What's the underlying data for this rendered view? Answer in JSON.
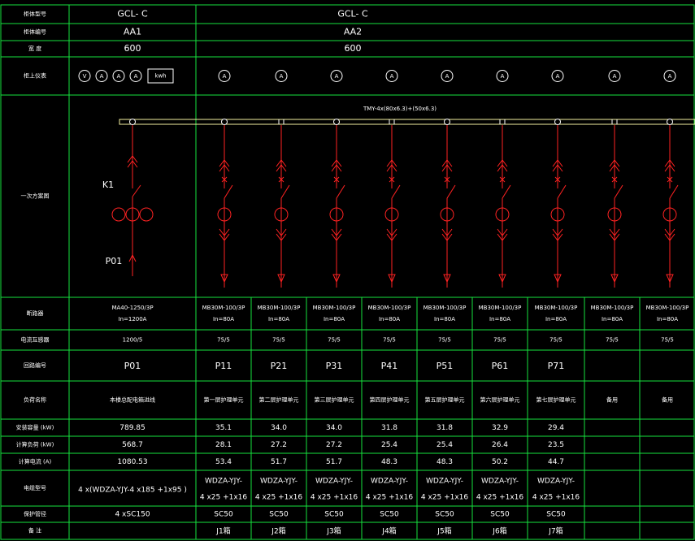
{
  "colors": {
    "background": "#000000",
    "grid": "#16e23e",
    "text": "#ffffff",
    "circuit": "#ff2222",
    "busbar": "#f5f0a0"
  },
  "row_labels": {
    "cabinet_model": "柜体型号",
    "cabinet_number": "柜体编号",
    "width": "宽 度",
    "meters": "柜上仪表",
    "one_line_diagram": "一次方案图",
    "breaker": "断路器",
    "current_transformer": "电流互感器",
    "circuit_number": "回路编号",
    "load_name": "负荷名称",
    "installed_load": "安装容量 (kW)",
    "calculated_load": "计算负荷 (kW)",
    "calculated_current": "计算电流 (A)",
    "cable_model": "电缆型号",
    "conduit": "保护管径",
    "remark": "备 注"
  },
  "header": {
    "aa1": {
      "model": "GCL- C",
      "number": "AA1",
      "width": "600"
    },
    "aa2": {
      "model": "GCL- C",
      "number": "AA2",
      "width": "600"
    }
  },
  "busbar_label": "TMY-4x(80x6.3)+(50x6.3)",
  "incoming": {
    "meters": [
      "V",
      "A",
      "A",
      "A"
    ],
    "kwh_label": "kwh",
    "switch_label": "K1",
    "circuit_label": "P01",
    "breaker": "MA40-1250/3P",
    "breaker_in": "In=1200A",
    "ct": "1200/5",
    "circuit": "P01",
    "load": "本楼总配电箱进线",
    "installed": "789.85",
    "calculated": "568.7",
    "current": "1080.53",
    "cable": "4 x(WDZA-YJY-4 x185 +1x95 )",
    "conduit": "4 xSC150",
    "remark": ""
  },
  "feeders": [
    {
      "meter": "A",
      "breaker": "MB30M-100/3P",
      "breaker_in": "In=80A",
      "ct": "75/5",
      "circuit": "P11",
      "load": "第一层护理单元",
      "installed": "35.1",
      "calculated": "28.1",
      "current": "53.4",
      "cable_l1": "WDZA-YJY-",
      "cable_l2": "4 x25 +1x16",
      "conduit": "SC50",
      "remark": "J1箱"
    },
    {
      "meter": "A",
      "breaker": "MB30M-100/3P",
      "breaker_in": "In=80A",
      "ct": "75/5",
      "circuit": "P21",
      "load": "第二层护理单元",
      "installed": "34.0",
      "calculated": "27.2",
      "current": "51.7",
      "cable_l1": "WDZA-YJY-",
      "cable_l2": "4 x25 +1x16",
      "conduit": "SC50",
      "remark": "J2箱"
    },
    {
      "meter": "A",
      "breaker": "MB30M-100/3P",
      "breaker_in": "In=80A",
      "ct": "75/5",
      "circuit": "P31",
      "load": "第三层护理单元",
      "installed": "34.0",
      "calculated": "27.2",
      "current": "51.7",
      "cable_l1": "WDZA-YJY-",
      "cable_l2": "4 x25 +1x16",
      "conduit": "SC50",
      "remark": "J3箱"
    },
    {
      "meter": "A",
      "breaker": "MB30M-100/3P",
      "breaker_in": "In=80A",
      "ct": "75/5",
      "circuit": "P41",
      "load": "第四层护理单元",
      "installed": "31.8",
      "calculated": "25.4",
      "current": "48.3",
      "cable_l1": "WDZA-YJY-",
      "cable_l2": "4 x25 +1x16",
      "conduit": "SC50",
      "remark": "J4箱"
    },
    {
      "meter": "A",
      "breaker": "MB30M-100/3P",
      "breaker_in": "In=80A",
      "ct": "75/5",
      "circuit": "P51",
      "load": "第五层护理单元",
      "installed": "31.8",
      "calculated": "25.4",
      "current": "48.3",
      "cable_l1": "WDZA-YJY-",
      "cable_l2": "4 x25 +1x16",
      "conduit": "SC50",
      "remark": "J5箱"
    },
    {
      "meter": "A",
      "breaker": "MB30M-100/3P",
      "breaker_in": "In=80A",
      "ct": "75/5",
      "circuit": "P61",
      "load": "第六层护理单元",
      "installed": "32.9",
      "calculated": "26.4",
      "current": "50.2",
      "cable_l1": "WDZA-YJY-",
      "cable_l2": "4 x25 +1x16",
      "conduit": "SC50",
      "remark": "J6箱"
    },
    {
      "meter": "A",
      "breaker": "MB30M-100/3P",
      "breaker_in": "In=80A",
      "ct": "75/5",
      "circuit": "P71",
      "load": "第七层护理单元",
      "installed": "29.4",
      "calculated": "23.5",
      "current": "44.7",
      "cable_l1": "WDZA-YJY-",
      "cable_l2": "4 x25 +1x16",
      "conduit": "SC50",
      "remark": "J7箱"
    },
    {
      "meter": "A",
      "breaker": "MB30M-100/3P",
      "breaker_in": "In=80A",
      "ct": "75/5",
      "circuit": "",
      "load": "备用",
      "installed": "",
      "calculated": "",
      "current": "",
      "cable_l1": "",
      "cable_l2": "",
      "conduit": "",
      "remark": ""
    },
    {
      "meter": "A",
      "breaker": "MB30M-100/3P",
      "breaker_in": "In=80A",
      "ct": "75/5",
      "circuit": "",
      "load": "备用",
      "installed": "",
      "calculated": "",
      "current": "",
      "cable_l1": "",
      "cable_l2": "",
      "conduit": "",
      "remark": ""
    }
  ]
}
